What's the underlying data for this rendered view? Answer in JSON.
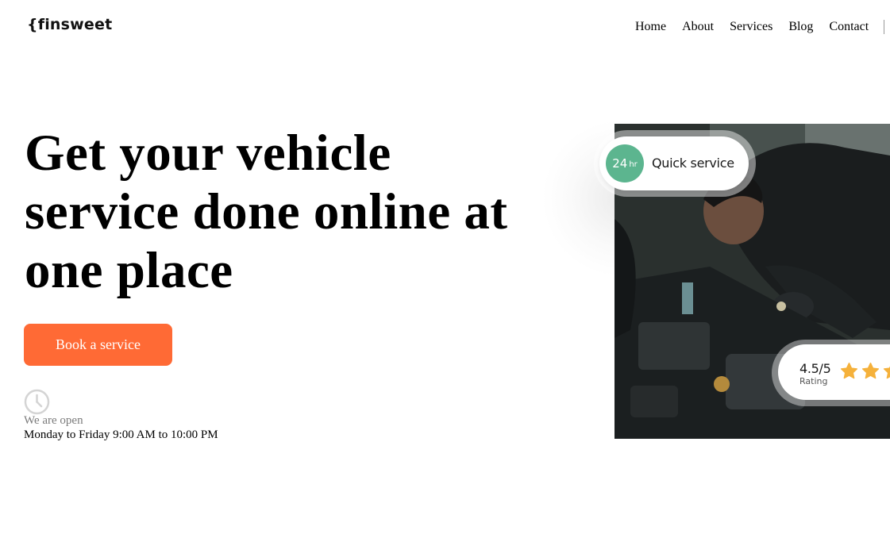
{
  "header": {
    "logo": "{finsweet",
    "nav": [
      "Home",
      "About",
      "Services",
      "Blog",
      "Contact"
    ]
  },
  "hero": {
    "title_lines": [
      "Get your vehicle",
      "service done online at",
      "one place"
    ],
    "cta_label": "Book a service",
    "open_label": "We are open",
    "open_hours": "Monday to Friday 9:00 AM to 10:00 PM"
  },
  "card": {
    "badge_number": "24",
    "badge_unit": "hr",
    "quick_label": "Quick service",
    "rating_value": "4.5/5",
    "rating_label": "Rating",
    "rating_score": 4.5,
    "rating_max": 5
  },
  "colors": {
    "accent": "#ff6a35",
    "badge_green": "#5cb58f",
    "star": "#f5b13b"
  },
  "icons": {
    "clock": "clock-icon",
    "star": "star-icon"
  }
}
